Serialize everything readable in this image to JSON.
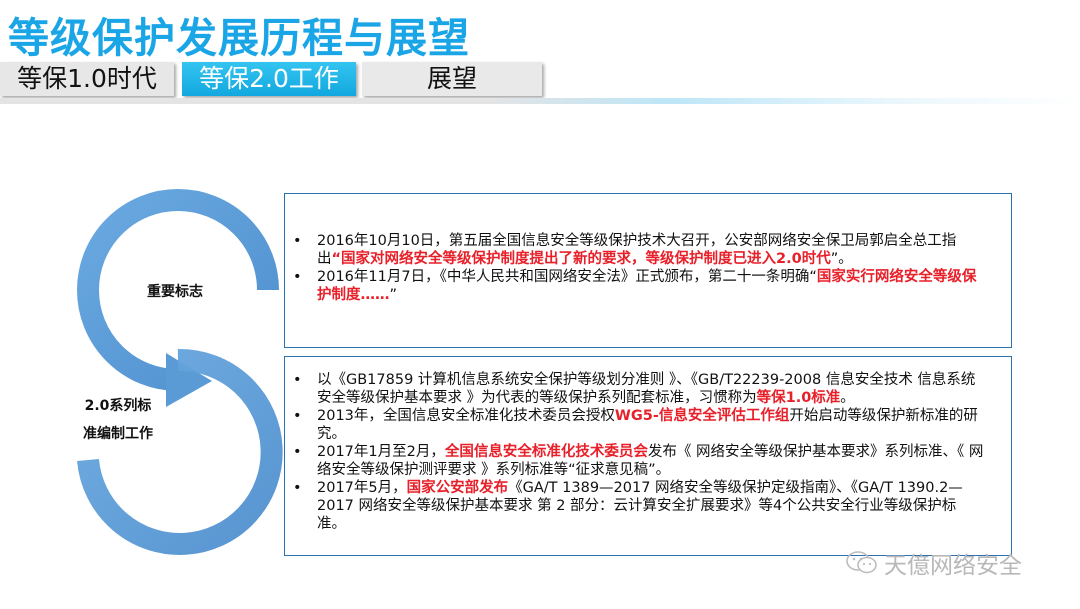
{
  "slide_title": "等级保护发展历程与展望",
  "tabs": [
    {
      "label": "等保1.0时代"
    },
    {
      "label": "等保2.0工作"
    },
    {
      "label": "展望"
    }
  ],
  "diagram": {
    "upper_label": "重要标志",
    "lower_label_line1": "2.0系列标",
    "lower_label_line2": "准编制工作"
  },
  "box1": {
    "item1_text": "2016年10月10日，第五届全国信息安全等级保护技术大召开，公安部网络安全保卫局郭启全总工指出",
    "item1_red": "“国家对网络安全等级保护制度提出了新的要求，等级保护制度已进入2.0时代",
    "item1_end": "”。",
    "item2_text": "2016年11月7日，《中华人民共和国网络安全法》正式颁布，第二十一条明确“",
    "item2_red": "国家实行网络安全等级保护制度……",
    "item2_end": "”"
  },
  "box2": {
    "item1_text": "以《GB17859 计算机信息系统安全保护等级划分准则 》、《GB/T22239-2008 信息安全技术 信息系统安全等级保护基本要求 》为代表的等级保护系列配套标准，习惯称为",
    "item1_red": "等保1.0标准",
    "item1_end": "。",
    "item2_a": "2013年，全国信息安全标准化技术委员会授权",
    "item2_red": "WG5-信息安全评估工作组",
    "item2_b": "开始启动等级保护新标准的研究。",
    "item3_a": "2017年1月至2月，",
    "item3_red": "全国信息安全标准化技术委员会",
    "item3_b": "发布《 网络安全等级保护基本要求》系列标准、《 网络安全等级保护测评要求 》系列标准等“征求意见稿”。",
    "item4_a": "2017年5月，",
    "item4_red": "国家公安部发布",
    "item4_b": "《GA/T 1389—2017 网络安全等级保护定级指南》、《GA/T 1390.2—2017 网络安全等级保护基本要求 第 2 部分：云计算安全扩展要求》等4个公共安全行业等级保护标准。"
  },
  "watermark": {
    "text": "天億网络安全",
    "icon": "wechat-icon"
  },
  "colors": {
    "title": "#1aa6e6",
    "active_tab": "#12a7df",
    "arrow": "#5b9bd5",
    "box_border": "#2a72b5",
    "highlight": "#e8202a"
  }
}
